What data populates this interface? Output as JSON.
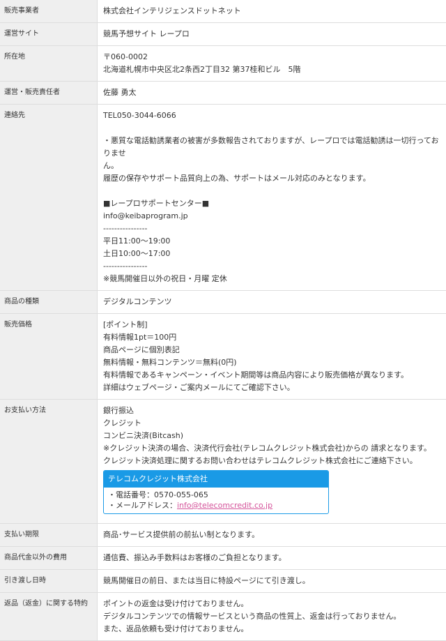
{
  "rows": {
    "seller": {
      "label": "販売事業者",
      "value": "株式会社インテリジェンスドットネット"
    },
    "site": {
      "label": "運営サイト",
      "value": "競馬予想サイト レープロ"
    },
    "address": {
      "label": "所在地",
      "postal": "〒060-0002",
      "street": "北海道札幌市中央区北2条西2丁目32 第37桂和ビル　5階"
    },
    "manager": {
      "label": "運営・販売責任者",
      "value": "佐藤 勇太"
    },
    "contact": {
      "label": "連絡先",
      "tel": "TEL050-3044-6066",
      "notice1": "・悪質な電話勧誘業者の被害が多数報告されておりますが、レープロでは電話勧誘は一切行っておりませ",
      "notice1b": "ん。",
      "notice2": "履歴の保存やサポート品質向上の為、サポートはメール対応のみとなります。",
      "center": "■レープロサポートセンター■",
      "email": "info@keibaprogram.jp",
      "sep1": "----------------",
      "weekday": "平日11:00～19:00",
      "saturday": "土日10:00～17:00",
      "sep2": "----------------",
      "holiday": "※競馬開催日以外の祝日・月曜 定休"
    },
    "product": {
      "label": "商品の種類",
      "value": "デジタルコンテンツ"
    },
    "price": {
      "label": "販売価格",
      "l1": "[ポイント制]",
      "l2": "有料情報1pt＝100円",
      "l3": "商品ページに個別表記",
      "l4": "無料情報・無料コンテンツ＝無料(0円)",
      "l5": "有料情報であるキャンペーン・イベント期間等は商品内容により販売価格が異なります。",
      "l6": "詳細はウェブページ・ご案内メールにてご確認下さい。"
    },
    "payment": {
      "label": "お支払い方法",
      "l1": "銀行振込",
      "l2": "クレジット",
      "l3": "コンビニ決済(Bitcash)",
      "l4": "※クレジット決済の場合、決済代行会社(テレコムクレジット株式会社)からの 請求となります。",
      "l5": "クレジット決済処理に関するお問い合わせはテレコムクレジット株式会社にご連絡下さい。",
      "box": {
        "title": "テレコムクレジット株式会社",
        "phone": "・電話番号：0570-055-065",
        "mail_prefix": "・メールアドレス：",
        "mail": "info@telecomcredit.co.jp"
      }
    },
    "deadline": {
      "label": "支払い期限",
      "value": "商品･サービス提供前の前払い制となります。"
    },
    "fees": {
      "label": "商品代金以外の費用",
      "value": "通信費、振込み手数料はお客様のご負担となります。"
    },
    "delivery": {
      "label": "引き渡し日時",
      "value": "競馬開催日の前日、または当日に特設ページにて引き渡し。"
    },
    "refund": {
      "label": "返品（返金）に関する特約",
      "l1": "ポイントの返金は受け付けておりません。",
      "l2": "デジタルコンテンツでの情報サービスという商品の性質上、返金は行っておりません。",
      "l3": "また、返品依頼も受け付けておりません。"
    }
  },
  "colors": {
    "label_bg": "#efefef",
    "border": "#dddddd",
    "box_accent": "#1a9ae6",
    "link": "#d4539a"
  }
}
